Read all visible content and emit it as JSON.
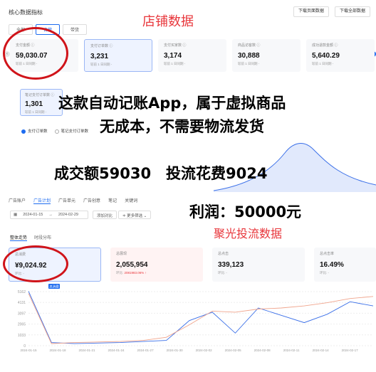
{
  "header": {
    "title": "核心数据指标",
    "download_page": "下载页面数据",
    "download_all": "下载全部数据"
  },
  "annotations": {
    "store_title": "店铺数据",
    "line1": "这款自动记账App，属于虚拟商品",
    "line2": "无成本，不需要物流发货",
    "line3": "成交额59030　投流花费9024",
    "line4": "利润：50000元",
    "juguang_title": "聚光投流数据"
  },
  "store": {
    "tabs": [
      "全部",
      "自营",
      "带货"
    ],
    "cards": [
      {
        "label": "支付金额 ⓘ",
        "value": "59,030.07",
        "sub": "较前 1 日同期 -"
      },
      {
        "label": "支付订单数 ⓘ",
        "value": "3,231",
        "sub": "较前 1 日同期 -"
      },
      {
        "label": "支付买家数 ⓘ",
        "value": "3,174",
        "sub": "较前 1 日同期 -"
      },
      {
        "label": "商品访客数 ⓘ",
        "value": "30,888",
        "sub": "较前 1 日同期 -"
      },
      {
        "label": "成功退款金额 ⓘ",
        "value": "5,640.29",
        "sub": "较前 1 日同期 -"
      }
    ],
    "overlay_card": {
      "label": "笔记支付订单数 ⓘ",
      "value": "1,301",
      "sub": "较前 1 日同期 -"
    },
    "legend": [
      "支付订单数",
      "笔记支付订单数"
    ]
  },
  "ads": {
    "tabs": [
      "广告账户",
      "广告计划",
      "广告单元",
      "广告创意",
      "笔记",
      "关键词"
    ],
    "active_tab": "广告计划",
    "date_start": "2024-01-15",
    "date_sep": "→",
    "date_end": "2024-02-29",
    "compare_btn": "添加对比",
    "filter_btn": "≑ 更多筛选 ⌄",
    "subtabs": [
      "整体走势",
      "时段分布"
    ],
    "cards": [
      {
        "label": "总消费",
        "value": "¥9,024.92",
        "sub": "环比: -",
        "trend": ""
      },
      {
        "label": "总展现",
        "value": "2,055,954",
        "sub": "环比:",
        "trend": "2081983.06% ↑"
      },
      {
        "label": "总点击",
        "value": "339,123",
        "sub": "环比: -",
        "trend": ""
      },
      {
        "label": "总点击率",
        "value": "16.49%",
        "sub": "环比: -",
        "trend": ""
      }
    ]
  },
  "colors": {
    "accent": "#1e6cf0",
    "red": "#e8363b",
    "orange_line": "#f0a48c"
  },
  "chart_data": {
    "type": "line",
    "yticks": [
      "5162",
      "4131",
      "3097",
      "2065",
      "1033",
      "0"
    ],
    "x": [
      "2024-01-15",
      "2024-01-18",
      "2024-01-21",
      "2024-01-24",
      "2024-01-27",
      "2024-01-30",
      "2024-02-02",
      "2024-02-05",
      "2024-02-08",
      "2024-02-11",
      "2024-02-14",
      "2024-02-17"
    ],
    "legend_tag": "总消费",
    "series": [
      {
        "color": "#3a6fe8",
        "values": [
          5200,
          300,
          200,
          250,
          300,
          400,
          500,
          2400,
          3200,
          1200,
          3600,
          2900,
          2200,
          3000,
          4200,
          3800
        ]
      },
      {
        "color": "#f0a48c",
        "values": [
          5000,
          200,
          300,
          350,
          400,
          500,
          800,
          2000,
          3300,
          3200,
          3500,
          3600,
          3800,
          4100,
          4500,
          4700
        ]
      }
    ],
    "ylim": [
      0,
      5162
    ]
  }
}
